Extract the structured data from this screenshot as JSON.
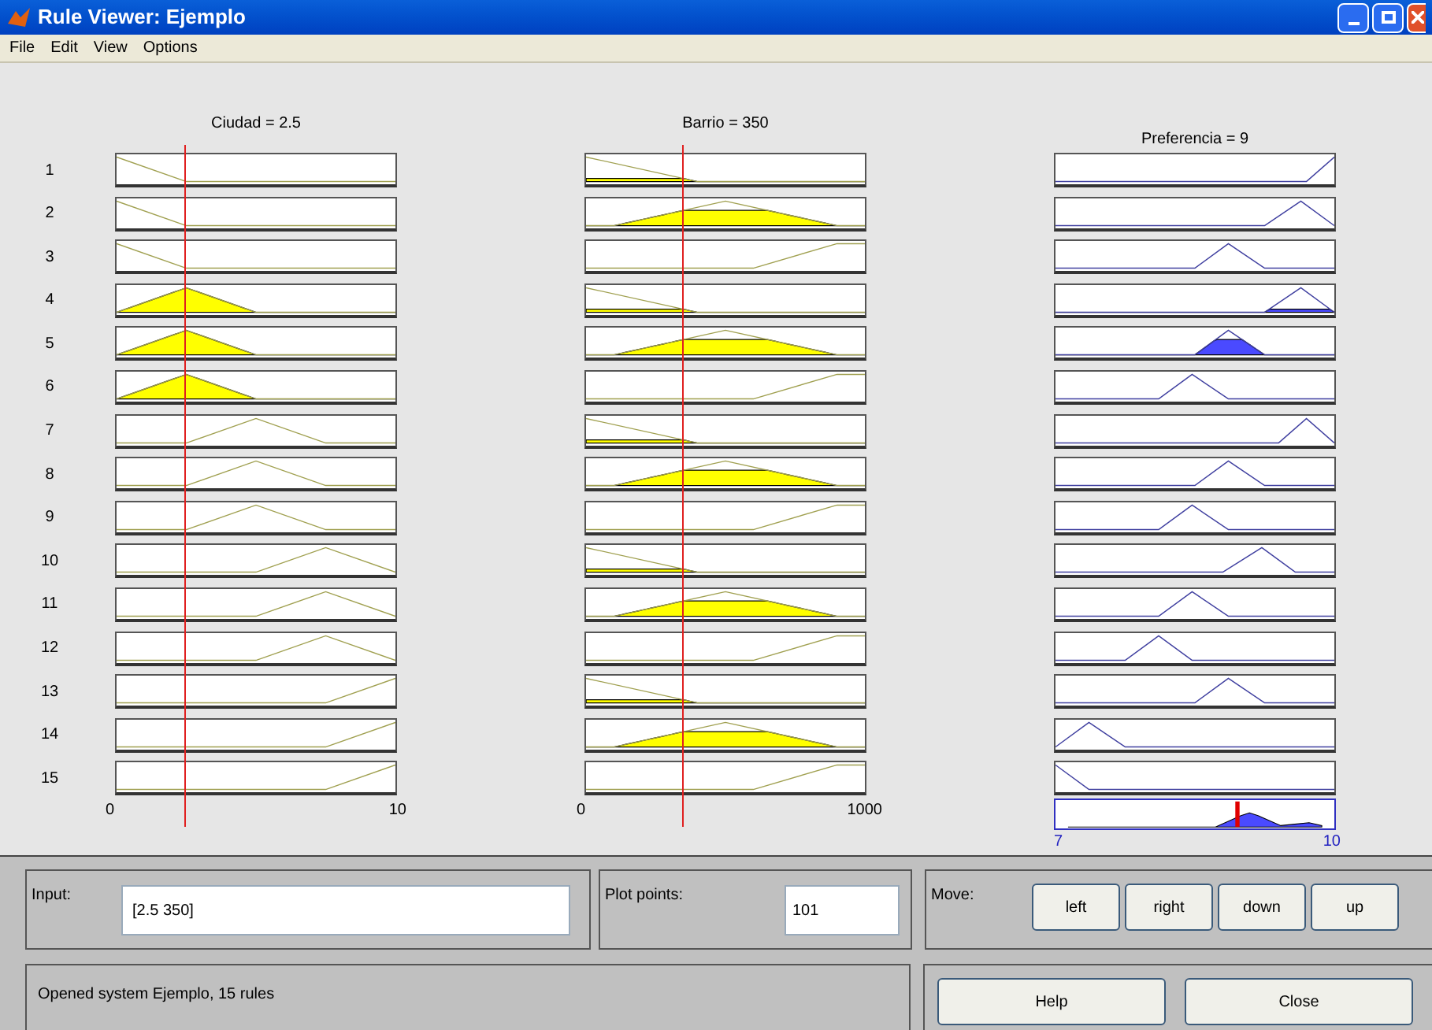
{
  "window": {
    "title": "Rule Viewer: Ejemplo"
  },
  "menu": [
    "File",
    "Edit",
    "View",
    "Options"
  ],
  "variables": [
    {
      "title": "Ciudad = 2.5",
      "axis_min": "0",
      "axis_max": "10"
    },
    {
      "title": "Barrio = 350",
      "axis_min": "0",
      "axis_max": "1000"
    },
    {
      "title": "Preferencia = 9",
      "axis_min": "7",
      "axis_max": "10"
    }
  ],
  "rules": [
    "1",
    "2",
    "3",
    "4",
    "5",
    "6",
    "7",
    "8",
    "9",
    "10",
    "11",
    "12",
    "13",
    "14",
    "15"
  ],
  "input": {
    "label": "Input:",
    "value": "[2.5 350]"
  },
  "plot_points": {
    "label": "Plot points:",
    "value": "101"
  },
  "move": {
    "label": "Move:",
    "buttons": [
      "left",
      "right",
      "down",
      "up"
    ]
  },
  "status": "Opened system Ejemplo, 15 rules",
  "buttons": [
    "Help",
    "Close"
  ]
}
